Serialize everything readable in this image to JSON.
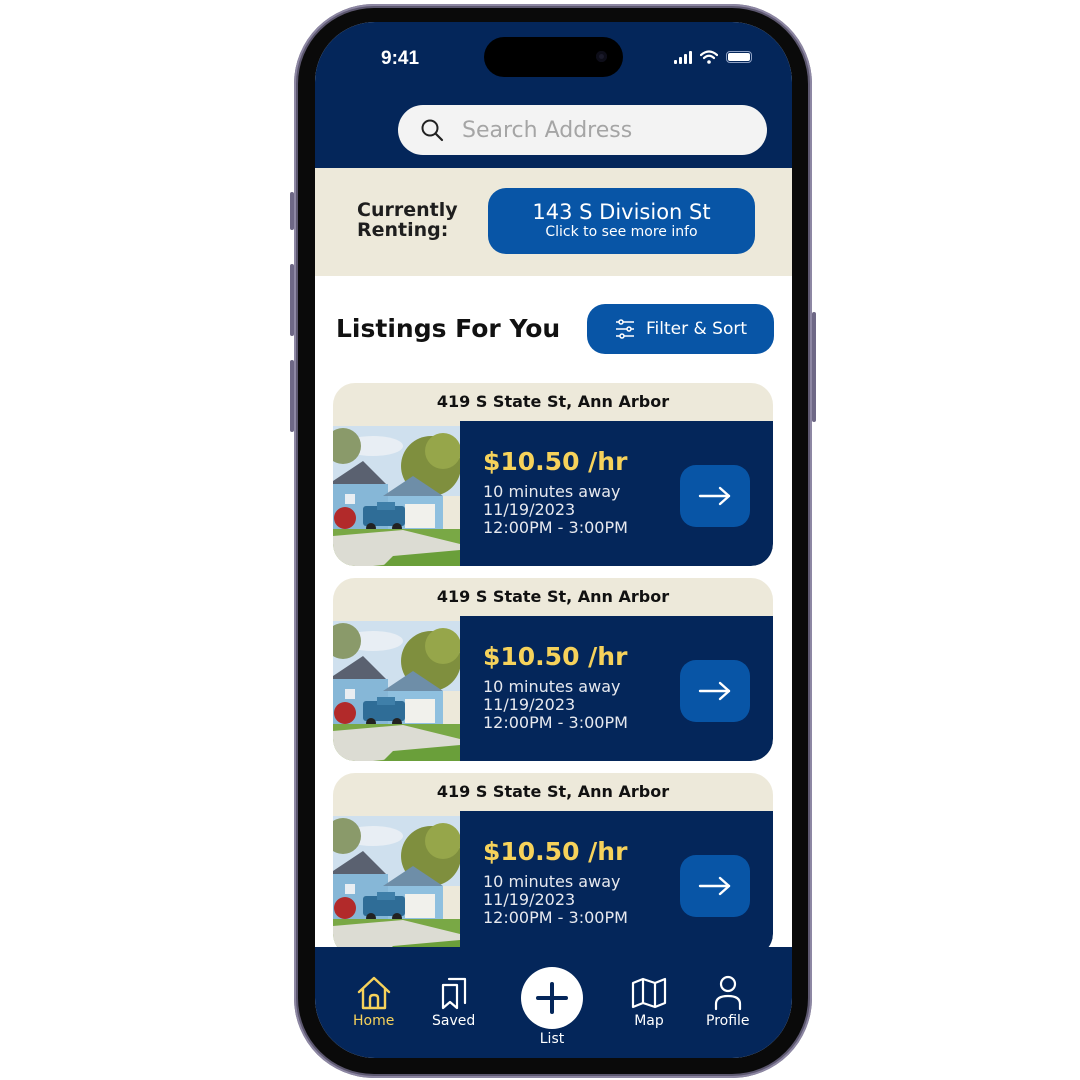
{
  "status_bar": {
    "time": "9:41"
  },
  "search": {
    "placeholder": "Search Address",
    "value": ""
  },
  "renting": {
    "label": "Currently Renting:",
    "label_line1": "Currently",
    "label_line2": "Renting:",
    "address": "143 S Division St",
    "hint": "Click to see more info"
  },
  "listings": {
    "title": "Listings For You",
    "filter_label": "Filter & Sort",
    "items": [
      {
        "address": "419 S State St, Ann Arbor",
        "price": "$10.50 /hr",
        "distance": "10 minutes away",
        "date": "11/19/2023",
        "time_range": "12:00PM - 3:00PM"
      },
      {
        "address": "419 S State St, Ann Arbor",
        "price": "$10.50 /hr",
        "distance": "10 minutes away",
        "date": "11/19/2023",
        "time_range": "12:00PM - 3:00PM"
      },
      {
        "address": "419 S State St, Ann Arbor",
        "price": "$10.50 /hr",
        "distance": "10 minutes away",
        "date": "11/19/2023",
        "time_range": "12:00PM - 3:00PM"
      }
    ]
  },
  "tabbar": {
    "items": [
      {
        "label": "Home",
        "icon": "home-icon",
        "active": true
      },
      {
        "label": "Saved",
        "icon": "bookmarks-icon",
        "active": false
      },
      {
        "label": "List",
        "icon": "plus-icon",
        "active": false
      },
      {
        "label": "Map",
        "icon": "map-icon",
        "active": false
      },
      {
        "label": "Profile",
        "icon": "person-icon",
        "active": false
      }
    ]
  },
  "colors": {
    "navy": "#04265a",
    "blue": "#0855a6",
    "cream": "#ede9da",
    "gold": "#f6d25b"
  }
}
